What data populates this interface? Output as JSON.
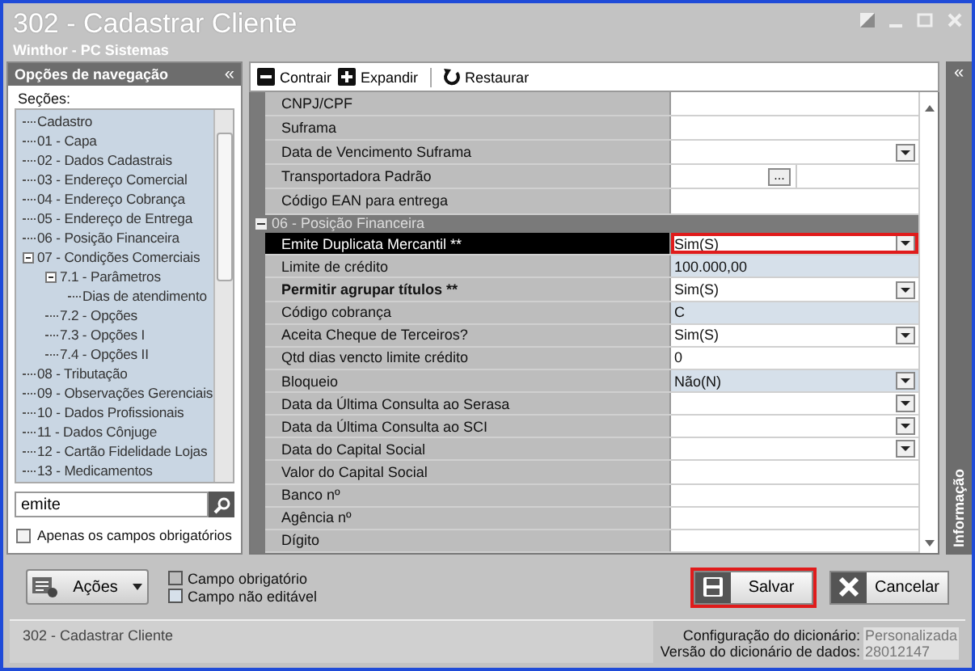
{
  "window": {
    "title": "302 - Cadastrar Cliente",
    "subtitle": "Winthor - PC Sistemas"
  },
  "navigation": {
    "title": "Opções de navegação",
    "collapse": "«",
    "sections_label": "Seções:",
    "tree": [
      {
        "label": "Cadastro"
      },
      {
        "label": "01 - Capa"
      },
      {
        "label": "02 - Dados Cadastrais"
      },
      {
        "label": "03 - Endereço Comercial"
      },
      {
        "label": "04 - Endereço Cobrança"
      },
      {
        "label": "05 - Endereço de Entrega"
      },
      {
        "label": "06 - Posição Financeira"
      },
      {
        "label": "07 - Condições Comerciais",
        "expanded": true,
        "children": [
          {
            "label": "7.1 - Parâmetros",
            "expanded": true,
            "children": [
              {
                "label": "Dias de atendimento"
              }
            ]
          },
          {
            "label": "7.2 - Opções"
          },
          {
            "label": "7.3 - Opções I"
          },
          {
            "label": "7.4 - Opções II"
          }
        ]
      },
      {
        "label": "08 - Tributação"
      },
      {
        "label": "09 - Observações Gerenciais"
      },
      {
        "label": "10 - Dados Profissionais"
      },
      {
        "label": "11 - Dados Cônjuge"
      },
      {
        "label": "12 - Cartão Fidelidade Lojas"
      },
      {
        "label": "13 - Medicamentos"
      }
    ],
    "search": {
      "value": "emite"
    },
    "only_required": {
      "label": "Apenas os campos obrigatórios",
      "checked": false
    }
  },
  "toolbar": [
    {
      "label": "Contrair",
      "kind": "collapse"
    },
    {
      "label": "Expandir",
      "kind": "expand"
    },
    {
      "label": "Restaurar",
      "kind": "restore"
    }
  ],
  "grid": {
    "rows": [
      {
        "kind": "text",
        "label": "CNPJ/CPF",
        "readonly": false,
        "bold": false,
        "selected": false
      },
      {
        "kind": "text",
        "label": "Suframa",
        "readonly": false,
        "bold": false,
        "selected": false
      },
      {
        "kind": "dropdown",
        "label": "Data de Vencimento Suframa",
        "readonly": false,
        "bold": false,
        "selected": false
      },
      {
        "kind": "lookup",
        "label": "Transportadora Padrão",
        "button": "...",
        "readonly": false,
        "bold": false,
        "selected": false
      },
      {
        "kind": "text",
        "label": "Código EAN para entrega",
        "readonly": false,
        "bold": false,
        "selected": false
      },
      {
        "kind": "group",
        "label": "06 - Posição Financeira",
        "expanded": true
      },
      {
        "kind": "dropdown",
        "label": "Emite Duplicata Mercantil **",
        "value": "Sim(S)",
        "readonly": false,
        "bold": false,
        "selected": true
      },
      {
        "kind": "text",
        "label": "Limite de crédito",
        "value": "100.000,00",
        "readonly": true,
        "bold": false,
        "selected": false
      },
      {
        "kind": "dropdown",
        "label": "Permitir agrupar títulos **",
        "value": "Sim(S)",
        "readonly": false,
        "bold": true,
        "selected": false
      },
      {
        "kind": "text",
        "label": "Código cobrança",
        "value": "C",
        "readonly": true,
        "bold": false,
        "selected": false
      },
      {
        "kind": "dropdown",
        "label": "Aceita Cheque de Terceiros?",
        "value": "Sim(S)",
        "readonly": false,
        "bold": false,
        "selected": false
      },
      {
        "kind": "text",
        "label": "Qtd dias vencto limite crédito",
        "value": "0",
        "readonly": false,
        "bold": false,
        "selected": false
      },
      {
        "kind": "dropdown",
        "label": "Bloqueio",
        "value": "Não(N)",
        "readonly": true,
        "bold": false,
        "selected": false
      },
      {
        "kind": "dropdown",
        "label": "Data da Última Consulta ao Serasa",
        "readonly": false,
        "bold": false,
        "selected": false
      },
      {
        "kind": "dropdown",
        "label": "Data da Última Consulta ao SCI",
        "readonly": false,
        "bold": false,
        "selected": false
      },
      {
        "kind": "dropdown",
        "label": "Data do Capital Social",
        "readonly": false,
        "bold": false,
        "selected": false
      },
      {
        "kind": "text",
        "label": "Valor do Capital Social",
        "readonly": false,
        "bold": false,
        "selected": false
      },
      {
        "kind": "text",
        "label": "Banco nº",
        "readonly": false,
        "bold": false,
        "selected": false
      },
      {
        "kind": "text",
        "label": "Agência nº",
        "readonly": false,
        "bold": false,
        "selected": false
      },
      {
        "kind": "text",
        "label": "Dígito",
        "readonly": false,
        "bold": false,
        "selected": false
      }
    ]
  },
  "info_panel": {
    "collapse": "«",
    "label": "Informação"
  },
  "actions": {
    "label": "Ações"
  },
  "legend": [
    {
      "label": "Campo obrigatório",
      "kind": "required"
    },
    {
      "label": "Campo não editável",
      "kind": "readonly"
    }
  ],
  "buttons": [
    {
      "label": "Salvar",
      "kind": "save",
      "highlighted": true
    },
    {
      "label": "Cancelar",
      "kind": "cancel",
      "highlighted": false
    }
  ],
  "status_bar": {
    "title": "302 - Cadastrar Cliente",
    "items": [
      {
        "label": "Configuração do dicionário:",
        "value": "Personalizada"
      },
      {
        "label": "Versão do dicionário de dados:",
        "value": "28012147"
      }
    ]
  }
}
